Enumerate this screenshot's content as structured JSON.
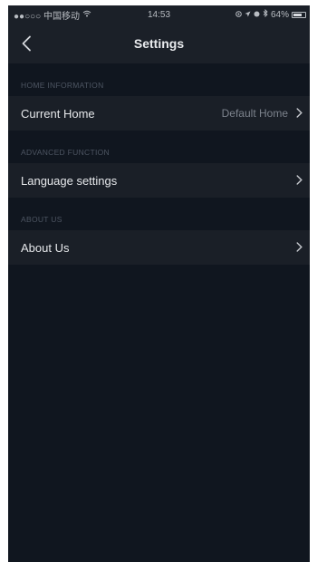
{
  "status_bar": {
    "carrier": "●●○○○ 中国移动",
    "wifi_icon": "wifi-icon",
    "time": "14:53",
    "battery_text": "64%"
  },
  "nav": {
    "title": "Settings",
    "back_icon": "chevron-left-icon"
  },
  "sections": [
    {
      "header": "HOME INFORMATION",
      "rows": [
        {
          "label": "Current Home",
          "value": "Default Home"
        }
      ]
    },
    {
      "header": "ADVANCED FUNCTION",
      "rows": [
        {
          "label": "Language settings",
          "value": ""
        }
      ]
    },
    {
      "header": "ABOUT US",
      "rows": [
        {
          "label": "About Us",
          "value": ""
        }
      ]
    }
  ],
  "colors": {
    "background": "#10161f",
    "row_background": "#1a1f27",
    "header_text": "#4d5562",
    "primary_text": "#e6e8eb",
    "secondary_text": "#7c828c"
  }
}
